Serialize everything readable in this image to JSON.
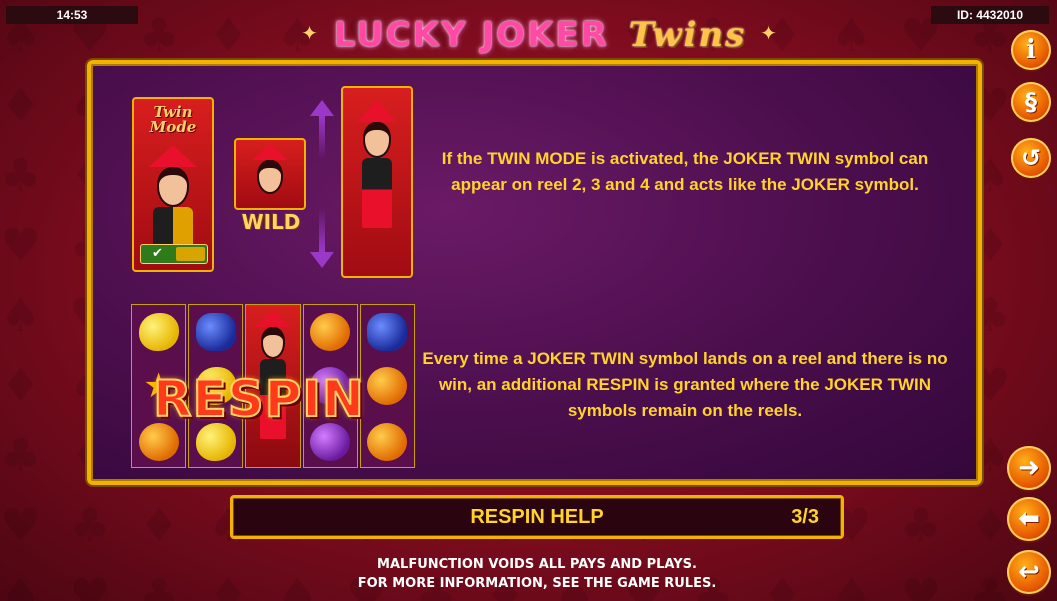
{
  "status": {
    "time": "14:53",
    "game_id": "ID: 4432010"
  },
  "title": {
    "main": "LUCKY JOKER",
    "accent": "Twins",
    "spark": "✦"
  },
  "panel": {
    "twin_mode_label_line1": "Twin",
    "twin_mode_label_line2": "Mode",
    "wild_label": "WILD",
    "respin_label": "RESPIN",
    "description_1": "If the TWIN MODE is activated, the JOKER TWIN symbol can appear on reel 2, 3 and 4 and acts like the JOKER symbol.",
    "description_2": "Every time a JOKER TWIN symbol lands on a reel and there is no win, an additional RESPIN is granted where the JOKER TWIN symbols remain on the reels."
  },
  "footer": {
    "section_title": "RESPIN HELP",
    "page_indicator": "3/3",
    "disclaimer_line1": "MALFUNCTION VOIDS ALL PAYS AND PLAYS.",
    "disclaimer_line2": "FOR MORE INFORMATION, SEE THE GAME RULES."
  },
  "side_buttons": {
    "info_icon": "i",
    "rules_icon": "§",
    "history_icon": "↺",
    "next_icon": "➜",
    "prev_icon": "⬅",
    "back_icon": "↩"
  },
  "colors": {
    "accent_gold": "#f2b200",
    "text_yellow": "#ffd32a",
    "button_orange": "#e85a00"
  }
}
